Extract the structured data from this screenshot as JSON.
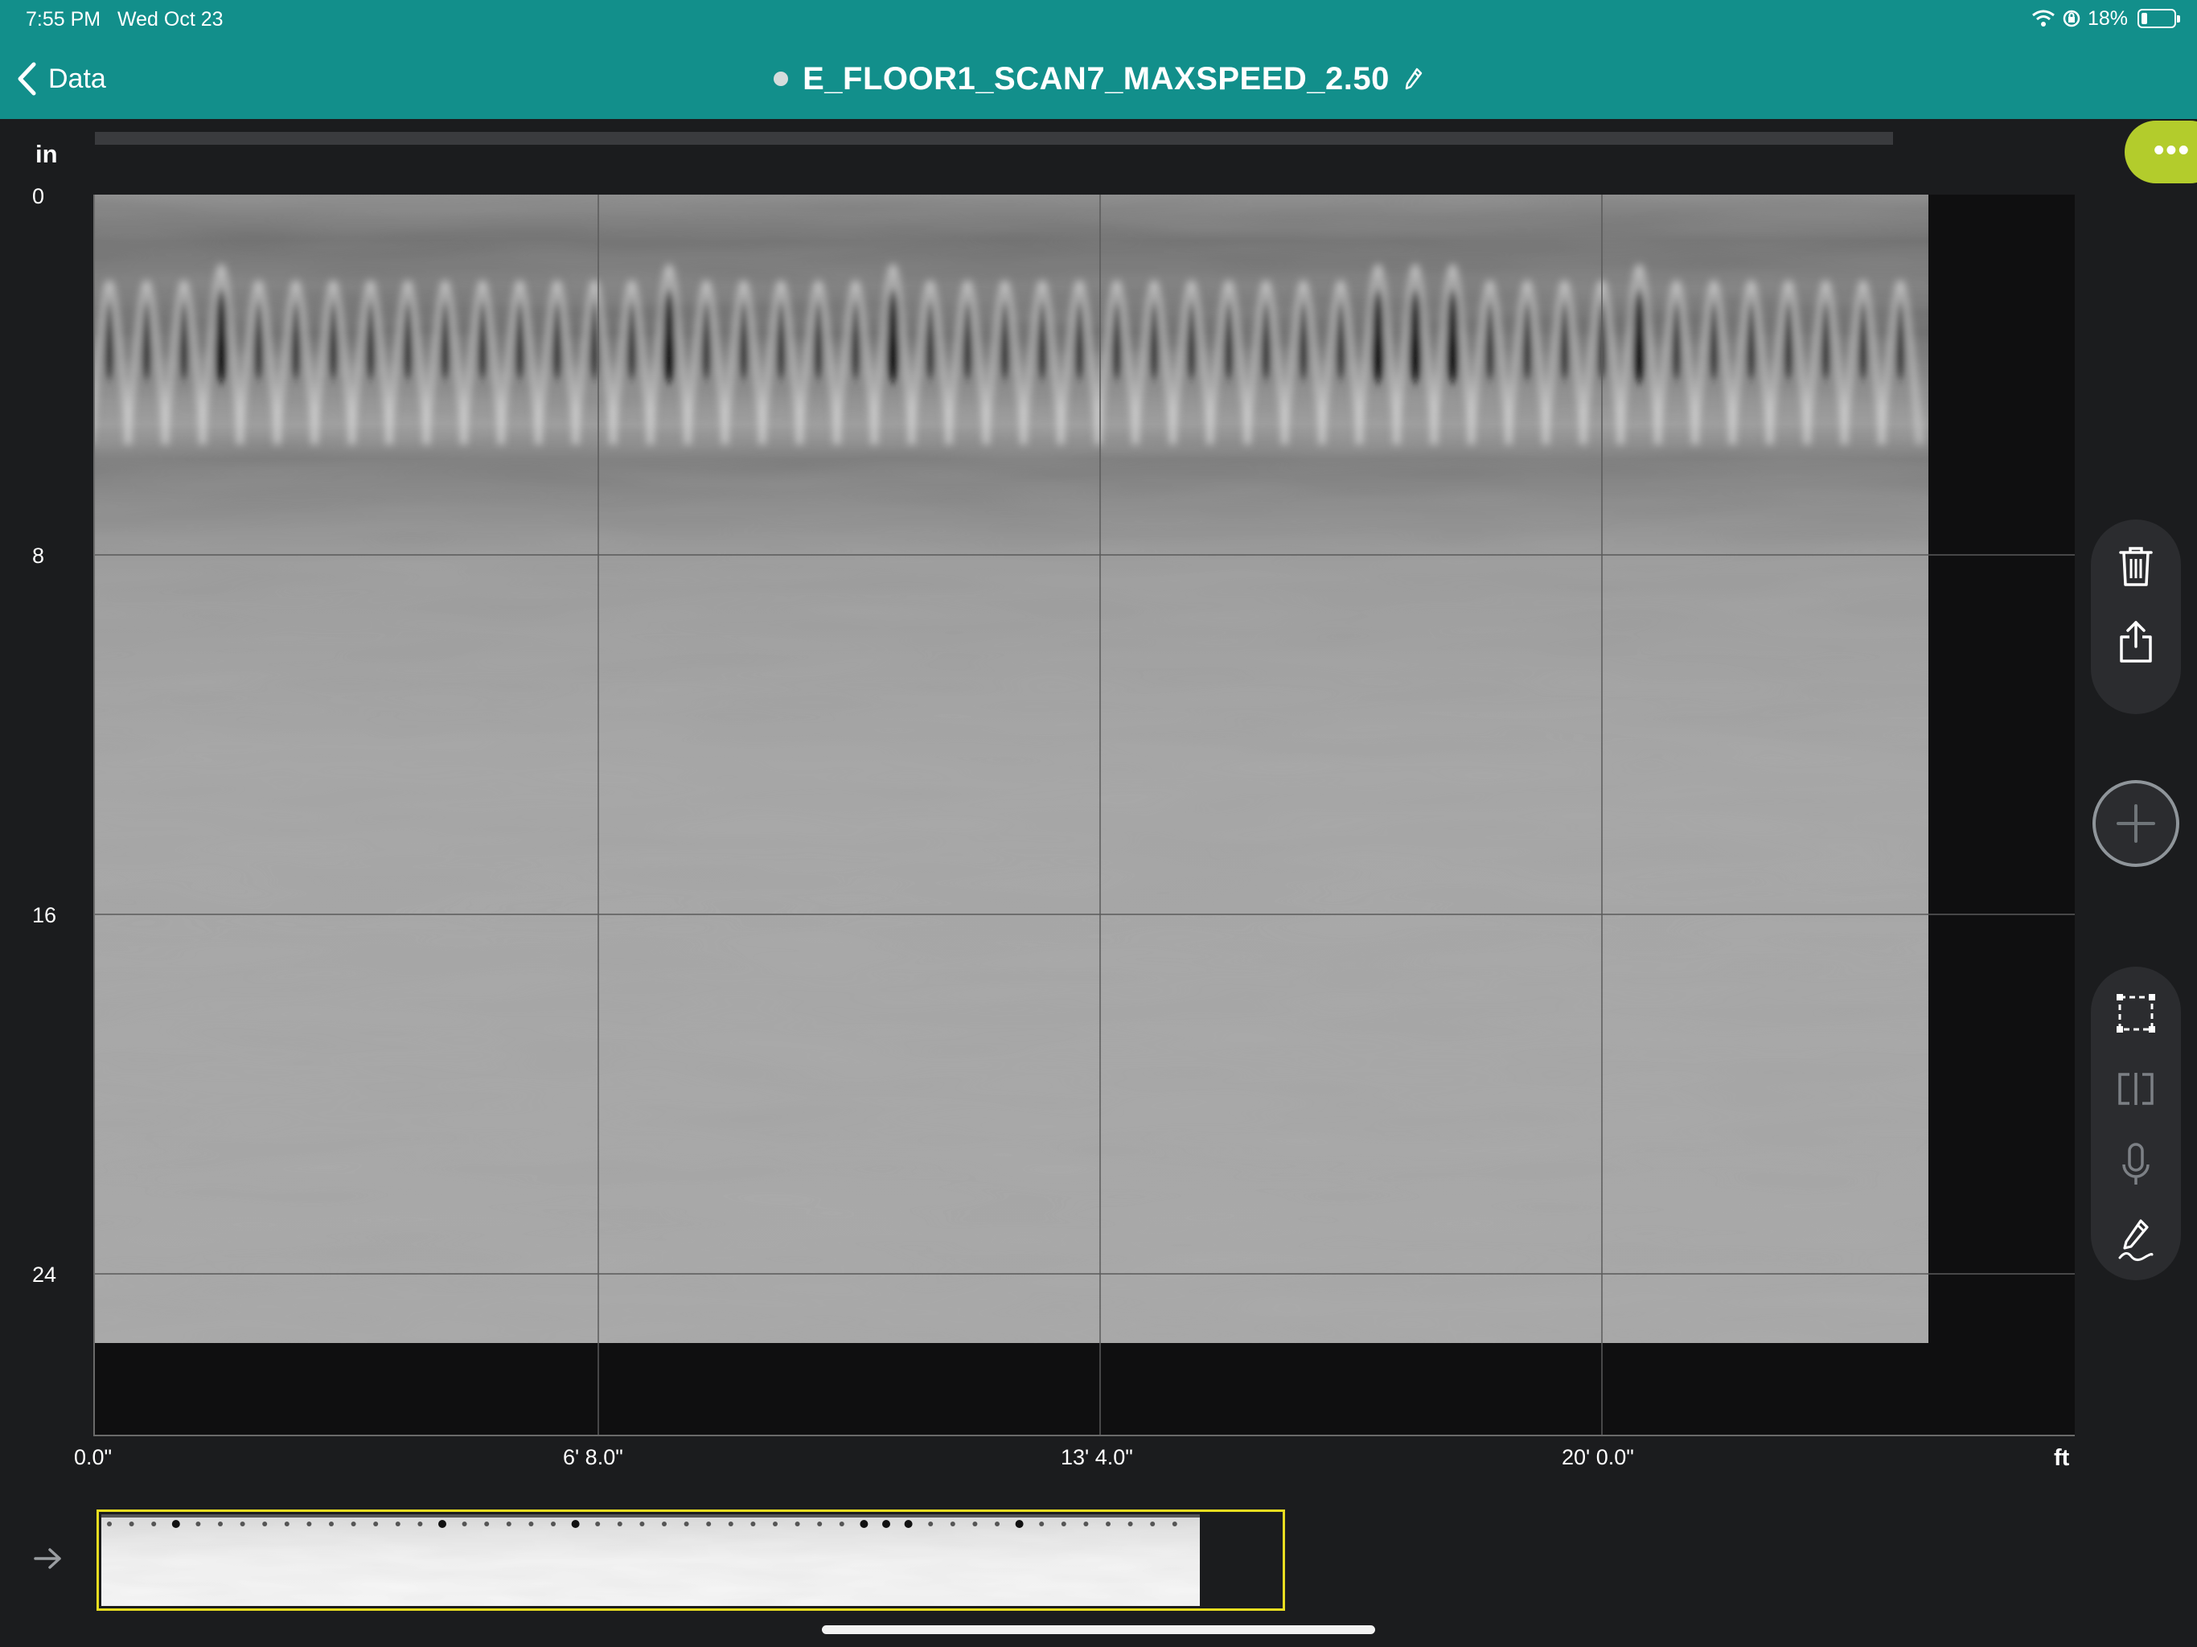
{
  "status_bar": {
    "time": "7:55 PM",
    "date": "Wed Oct 23",
    "battery": "18%",
    "battery_level": 0.18
  },
  "nav": {
    "back_label": "Data",
    "title": "E_FLOOR1_SCAN7_MAXSPEED_2.50",
    "icons": [
      "chevron-left-icon",
      "status-dot-icon",
      "pencil-edit-icon",
      "wifi-icon",
      "orientation-lock-icon",
      "battery-icon"
    ]
  },
  "radargram": {
    "depth_unit": "in",
    "depth_ticks": [
      "0",
      "8",
      "16",
      "24"
    ],
    "distance_unit": "ft",
    "distance_ticks": [
      "0.0\"",
      "6' 8.0\"",
      "13' 4.0\"",
      "20' 0.0\""
    ]
  },
  "tools": {
    "more_label": "•••",
    "icons": [
      "more-icon",
      "trash-icon",
      "share-icon",
      "add-icon",
      "select-region-icon",
      "split-view-icon",
      "microphone-icon",
      "annotate-pen-icon",
      "arrow-right-icon"
    ]
  },
  "colors": {
    "header": "#128f8b",
    "more_button": "#b3cc2c",
    "overview_border": "#e8dd20",
    "background": "#1b1c1e",
    "tool_panel": "#2b2c2f"
  }
}
